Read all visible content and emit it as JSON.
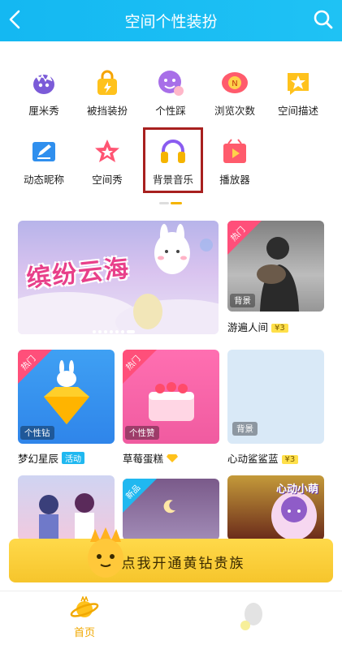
{
  "header": {
    "title": "空间个性装扮"
  },
  "features": [
    {
      "label": "厘米秀",
      "icon": "cm-show-icon"
    },
    {
      "label": "被挡装扮",
      "icon": "lock-bag-icon"
    },
    {
      "label": "个性踩",
      "icon": "footprint-face-icon"
    },
    {
      "label": "浏览次数",
      "icon": "view-count-icon"
    },
    {
      "label": "空间描述",
      "icon": "star-flag-icon"
    },
    {
      "label": "动态昵称",
      "icon": "edit-name-icon"
    },
    {
      "label": "空间秀",
      "icon": "space-show-star-icon"
    },
    {
      "label": "背景音乐",
      "icon": "headphones-icon"
    },
    {
      "label": "播放器",
      "icon": "player-icon"
    }
  ],
  "banner": {
    "text": "缤纷云海"
  },
  "cards": {
    "c1": {
      "name": "游遍人间",
      "price": "¥3",
      "badge": "热门",
      "tag": "背景"
    },
    "c2": {
      "name": "梦幻星辰",
      "extra": "活动",
      "badge": "热门",
      "tag": "个性钻"
    },
    "c3": {
      "name": "草莓蛋糕",
      "badge": "热门",
      "tag": "个性赞"
    },
    "c4": {
      "name": "心动鲨鲨蓝",
      "price": "¥3",
      "tag": "背景"
    },
    "c5": {
      "name": ""
    },
    "c6": {
      "badge": "新品"
    },
    "c7": {
      "logo": "心动小萌"
    }
  },
  "vip": {
    "text": "点我开通黄钻贵族"
  },
  "tabbar": {
    "home_label": "首页"
  },
  "colors": {
    "brand": "#1ab9f2",
    "highlight": "#a8201f",
    "vip": "#ffd94a",
    "hot": "#ff4f7a"
  }
}
